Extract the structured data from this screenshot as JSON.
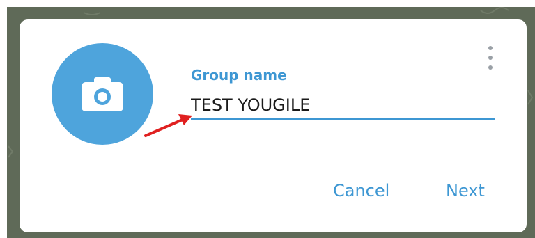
{
  "dialog": {
    "field_label": "Group name",
    "field_value": "TEST YOUGILE",
    "cancel_label": "Cancel",
    "next_label": "Next"
  },
  "icons": {
    "avatar_icon": "camera-icon",
    "menu_icon": "more-vertical-icon"
  },
  "colors": {
    "accent": "#3e97d3",
    "avatar_bg": "#4ea4dc",
    "annotation_arrow": "#e02020"
  }
}
